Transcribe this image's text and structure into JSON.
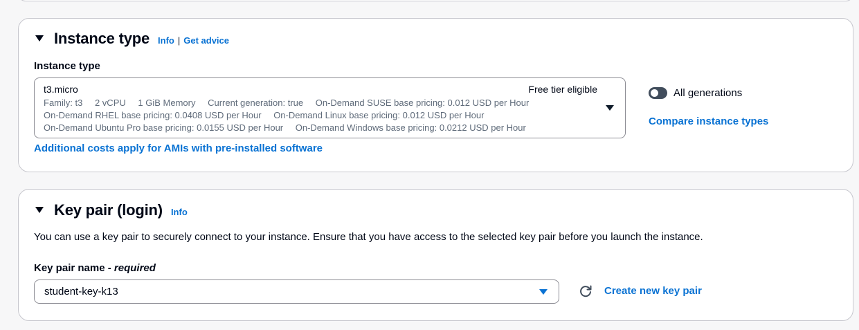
{
  "instance_type_section": {
    "title": "Instance type",
    "info_label": "Info",
    "separator": "|",
    "advice_label": "Get advice",
    "field_label": "Instance type",
    "selected": {
      "name": "t3.micro",
      "tag": "Free tier eligible",
      "line1": [
        "Family: t3",
        "2 vCPU",
        "1 GiB Memory",
        "Current generation: true",
        "On-Demand SUSE base pricing: 0.012 USD per Hour"
      ],
      "line2": [
        "On-Demand RHEL base pricing: 0.0408 USD per Hour",
        "On-Demand Linux base pricing: 0.012 USD per Hour"
      ],
      "line3": [
        "On-Demand Ubuntu Pro base pricing: 0.0155 USD per Hour",
        "On-Demand Windows base pricing: 0.0212 USD per Hour"
      ]
    },
    "additional_costs_link": "Additional costs apply for AMIs with pre-installed software",
    "all_generations_label": "All generations",
    "all_generations_on": false,
    "compare_link": "Compare instance types"
  },
  "key_pair_section": {
    "title": "Key pair (login)",
    "info_label": "Info",
    "description": "You can use a key pair to securely connect to your instance. Ensure that you have access to the selected key pair before you launch the instance.",
    "field_label": "Key pair name - ",
    "field_required": "required",
    "selected_value": "student-key-k13",
    "create_link": "Create new key pair"
  },
  "icons": {
    "collapse": "caret-down-icon",
    "dropdown": "caret-down-icon",
    "refresh": "refresh-icon"
  },
  "colors": {
    "link": "#0972d3",
    "text": "#000716",
    "secondary_text": "#5f6b7a",
    "border": "#c6c6cd",
    "toggle_off": "#414d5c"
  }
}
